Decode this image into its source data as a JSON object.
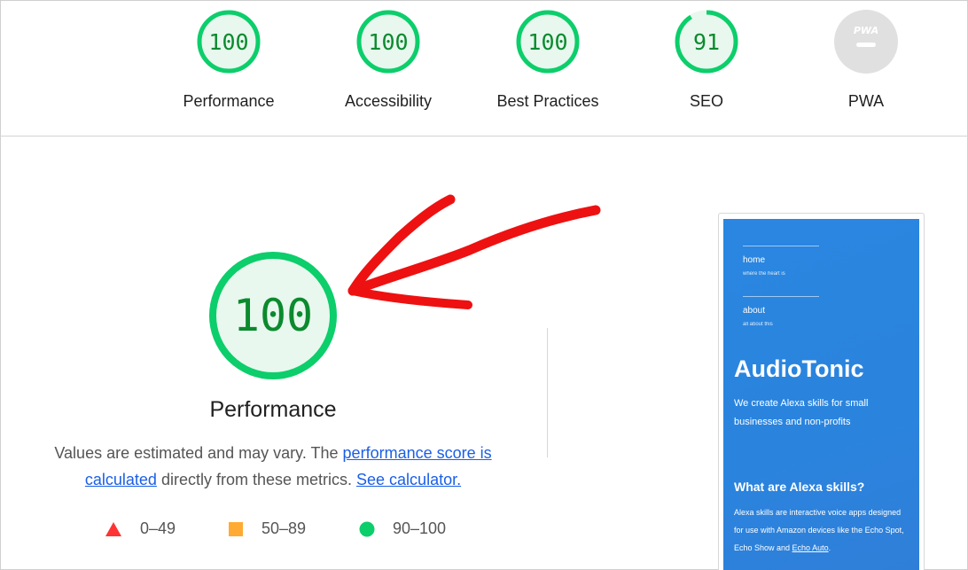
{
  "categories": [
    {
      "score": "100",
      "label": "Performance",
      "fraction": 1.0,
      "color": "#0cce6b"
    },
    {
      "score": "100",
      "label": "Accessibility",
      "fraction": 1.0,
      "color": "#0cce6b"
    },
    {
      "score": "100",
      "label": "Best Practices",
      "fraction": 1.0,
      "color": "#0cce6b"
    },
    {
      "score": "91",
      "label": "SEO",
      "fraction": 0.91,
      "color": "#0cce6b"
    },
    {
      "score": "PWA",
      "label": "PWA",
      "fraction": 0,
      "color": "#cccccc"
    }
  ],
  "performance": {
    "score": "100",
    "title": "Performance",
    "desc_prefix": "Values are estimated and may vary. The ",
    "desc_link1": "performance score is calculated",
    "desc_middle": " directly from these metrics. ",
    "desc_link2": "See calculator."
  },
  "legend": [
    {
      "range": "0–49",
      "shape": "triangle-icon",
      "color": "#ff3333"
    },
    {
      "range": "50–89",
      "shape": "square-icon",
      "color": "#ffaa33"
    },
    {
      "range": "90–100",
      "shape": "circle-icon",
      "color": "#0cce6b"
    }
  ],
  "thumbnail": {
    "nav1": "home",
    "nav1_sub": "where the heart is",
    "nav2": "about",
    "nav2_sub": "all about this",
    "brand": "AudioTonic",
    "tagline": "We create Alexa skills for small businesses and non-profits",
    "heading": "What are Alexa skills?",
    "para_prefix": "Alexa skills are interactive voice apps designed for use with Amazon devices like the Echo Spot, Echo Show and ",
    "para_link": "Echo Auto",
    "para_suffix": "."
  },
  "annotation_color": "#ee1111"
}
